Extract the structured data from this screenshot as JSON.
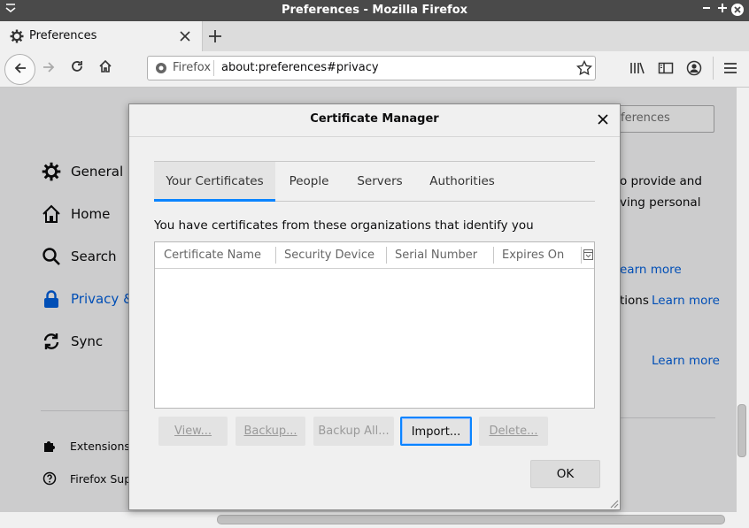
{
  "window": {
    "title": "Preferences - Mozilla Firefox"
  },
  "tab": {
    "title": "Preferences"
  },
  "urlbar": {
    "identity": "Firefox",
    "url": "about:preferences#privacy"
  },
  "sidebar": {
    "items": [
      {
        "label": "General",
        "icon": "gear-icon"
      },
      {
        "label": "Home",
        "icon": "home-icon"
      },
      {
        "label": "Search",
        "icon": "search-icon"
      },
      {
        "label": "Privacy &",
        "icon": "lock-icon"
      },
      {
        "label": "Sync",
        "icon": "sync-icon"
      }
    ],
    "footer": [
      {
        "label": "Extensions &",
        "icon": "puzzle-icon"
      },
      {
        "label": "Firefox Supp",
        "icon": "help-icon"
      }
    ]
  },
  "background": {
    "search_placeholder": "ferences",
    "text1": "o provide and",
    "text2": "ving personal",
    "learn_more_1": "earn more",
    "text3": "tions",
    "learn_more_2": "Learn more",
    "learn_more_3": "Learn more"
  },
  "dialog": {
    "title": "Certificate Manager",
    "tabs": [
      "Your Certificates",
      "People",
      "Servers",
      "Authorities"
    ],
    "selected_tab": "Your Certificates",
    "intro": "You have certificates from these organizations that identify you",
    "columns": [
      "Certificate Name",
      "Security Device",
      "Serial Number",
      "Expires On"
    ],
    "buttons": {
      "view": "View...",
      "backup": "Backup...",
      "backup_all": "Backup All...",
      "import": "Import...",
      "delete": "Delete..."
    },
    "ok": "OK"
  },
  "colors": {
    "accent": "#0a84ff",
    "link": "#0060df",
    "titlebar": "#4a4a4a",
    "privacy_selected": "#0060df"
  }
}
